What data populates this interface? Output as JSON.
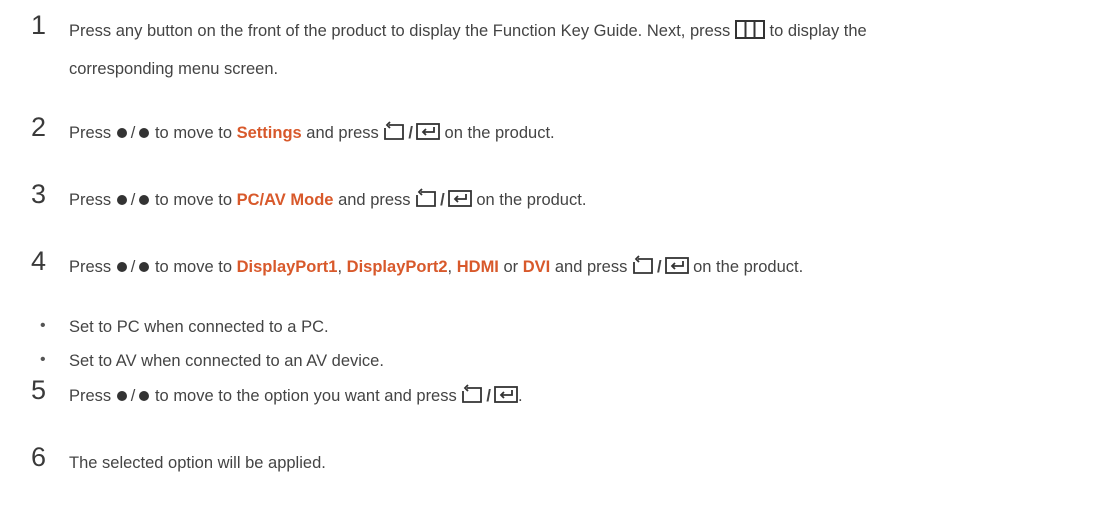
{
  "steps": [
    {
      "number": "1",
      "parts": [
        "Press any button on the front of the product to display the Function Key Guide. Next, press",
        "to display the",
        "corresponding menu screen."
      ]
    },
    {
      "number": "2",
      "pre": "Press",
      "mid": "to move to",
      "targets": [
        "Settings"
      ],
      "post": "and press",
      "end": "on the product."
    },
    {
      "number": "3",
      "pre": "Press",
      "mid": "to move to",
      "targets": [
        "PC/AV Mode"
      ],
      "post": "and press",
      "end": "on the product."
    },
    {
      "number": "4",
      "pre": "Press",
      "mid": "to move to",
      "targets": [
        "DisplayPort1",
        "DisplayPort2",
        "HDMI",
        "DVI"
      ],
      "separators": [
        ",",
        ",",
        "or"
      ],
      "post": "and press",
      "end": "on the product."
    },
    {
      "number": "5",
      "pre": "Press",
      "mid": "to move to the option you want and press",
      "end": "."
    },
    {
      "number": "6",
      "text": "The selected option will be applied."
    }
  ],
  "bullets": [
    "Set to PC when connected to a PC.",
    "Set to AV when connected to an AV device."
  ],
  "symbols": {
    "slash": "/",
    "bullet": "•"
  },
  "icons": [
    "dot-icon",
    "menu-grid-icon",
    "return-icon",
    "source-enter-icon"
  ],
  "colors": {
    "highlight": "#d8592b",
    "text": "#444444"
  }
}
